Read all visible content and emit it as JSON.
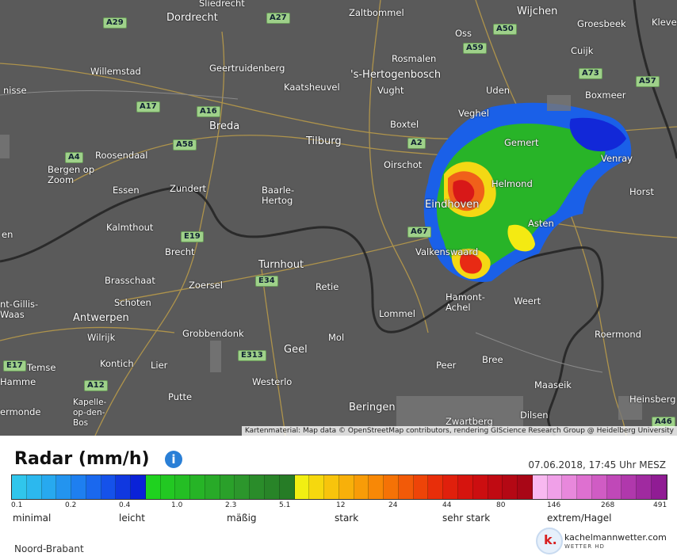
{
  "map": {
    "places": [
      {
        "name": "Sliedrecht"
      },
      {
        "name": "Dordrecht"
      },
      {
        "name": "Zaltbommel"
      },
      {
        "name": "Wijchen"
      },
      {
        "name": "Oss"
      },
      {
        "name": "Groesbeek"
      },
      {
        "name": "Kleve"
      },
      {
        "name": "Cuijk"
      },
      {
        "name": "Willemstad"
      },
      {
        "name": "Geertruidenberg"
      },
      {
        "name": "Rosmalen"
      },
      {
        "name": "'s-Hertogenbosch"
      },
      {
        "name": "Kaatsheuvel"
      },
      {
        "name": "Vught"
      },
      {
        "name": "Uden"
      },
      {
        "name": "Boxmeer"
      },
      {
        "name": "nisse"
      },
      {
        "name": "Veghel"
      },
      {
        "name": "Breda"
      },
      {
        "name": "Tilburg"
      },
      {
        "name": "Boxtel"
      },
      {
        "name": "Gemert"
      },
      {
        "name": "Roosendaal"
      },
      {
        "name": "Venray"
      },
      {
        "name": "Bergen op Zoom"
      },
      {
        "name": "Oirschot"
      },
      {
        "name": "Essen"
      },
      {
        "name": "Zundert"
      },
      {
        "name": "Baarle-Hertog"
      },
      {
        "name": "Helmond"
      },
      {
        "name": "Horst"
      },
      {
        "name": "Eindhoven"
      },
      {
        "name": "Kalmthout"
      },
      {
        "name": "Asten"
      },
      {
        "name": "en"
      },
      {
        "name": "Brecht"
      },
      {
        "name": "Valkenswaard"
      },
      {
        "name": "Turnhout"
      },
      {
        "name": "Brasschaat"
      },
      {
        "name": "Zoersel"
      },
      {
        "name": "Retie"
      },
      {
        "name": "Hamont-Achel"
      },
      {
        "name": "nt-Gillis-Waas"
      },
      {
        "name": "Schoten"
      },
      {
        "name": "Weert"
      },
      {
        "name": "Antwerpen"
      },
      {
        "name": "Lommel"
      },
      {
        "name": "Wilrijk"
      },
      {
        "name": "Grobbendonk"
      },
      {
        "name": "Mol"
      },
      {
        "name": "Roermond"
      },
      {
        "name": "Geel"
      },
      {
        "name": "Bree"
      },
      {
        "name": "Temse"
      },
      {
        "name": "Kontich"
      },
      {
        "name": "Lier"
      },
      {
        "name": "Peer"
      },
      {
        "name": "Hamme"
      },
      {
        "name": "Westerlo"
      },
      {
        "name": "Maaseik"
      },
      {
        "name": "Putte"
      },
      {
        "name": "Heinsberg"
      },
      {
        "name": "Kapelle-op-den-Bos"
      },
      {
        "name": "ermonde"
      },
      {
        "name": "Beringen"
      },
      {
        "name": "Dilsen"
      },
      {
        "name": "Zwartberg"
      }
    ],
    "roads": [
      "A29",
      "A27",
      "A50",
      "A59",
      "A73",
      "A57",
      "A17",
      "A16",
      "A58",
      "A2",
      "A4",
      "E19",
      "A67",
      "E34",
      "E313",
      "E17",
      "A12",
      "A46"
    ],
    "attribution": "Kartenmaterial: Map data © OpenStreetMap contributors, rendering GIScience Research Group @ Heidelberg University"
  },
  "legend": {
    "title": "Radar (mm/h)",
    "info_icon": "info-icon",
    "timestamp": "07.06.2018, 17:45 Uhr MESZ",
    "ticks": [
      "0.1",
      "0.2",
      "0.4",
      "1.0",
      "2.3",
      "5.1",
      "12",
      "24",
      "44",
      "80",
      "146",
      "268",
      "491"
    ],
    "categories": [
      "minimal",
      "leicht",
      "mäßig",
      "stark",
      "sehr stark",
      "extrem/Hagel"
    ],
    "colors": [
      "#30c6ec",
      "#2cb8ee",
      "#27a9ef",
      "#2394ef",
      "#1e7ff0",
      "#1a68ee",
      "#1552ea",
      "#1038e0",
      "#0a22d8",
      "#1fd21f",
      "#22c822",
      "#24be24",
      "#26b426",
      "#28aa28",
      "#2aa02a",
      "#2c962c",
      "#2a8c2a",
      "#288428",
      "#267c26",
      "#f2ef12",
      "#f6d80e",
      "#f8c40c",
      "#f8b00a",
      "#f89c08",
      "#f88806",
      "#f57206",
      "#f25a08",
      "#ee4408",
      "#e82e0a",
      "#e0200c",
      "#d6140e",
      "#cc0e10",
      "#c00a12",
      "#b40814",
      "#a80616",
      "#f8b8f0",
      "#f0a0e8",
      "#e888dc",
      "#de70d0",
      "#d05cc4",
      "#c048b8",
      "#b038ac",
      "#a02aa0",
      "#901c94"
    ],
    "region": "Noord-Brabant",
    "brand": "kachelmannwetter.com",
    "brand_sub": "WETTER HD",
    "logo_letter": "k."
  }
}
